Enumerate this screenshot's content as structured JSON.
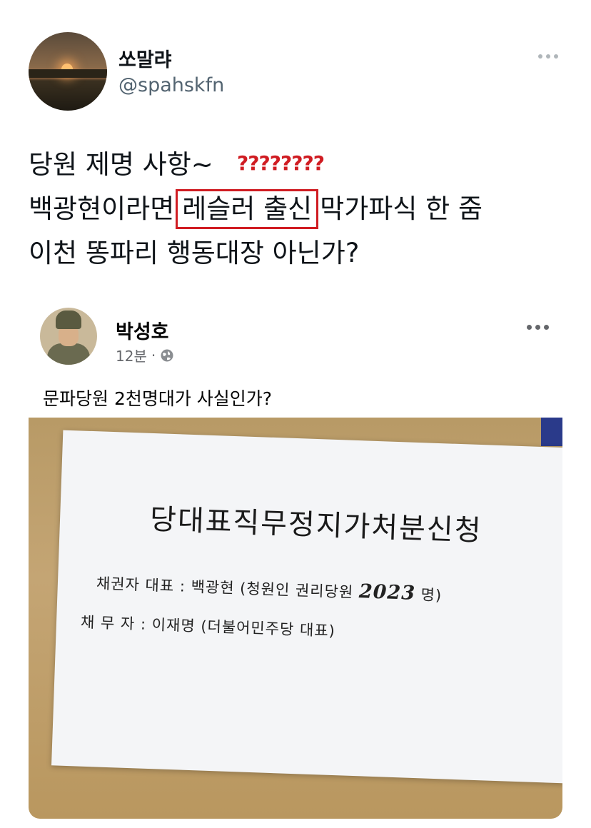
{
  "tweet": {
    "display_name": "쏘말랴",
    "handle": "@spahskfn",
    "line1": "당원 제명 사항~",
    "annotation": "????????",
    "line2_before": "백광현이라면",
    "line2_highlight": "레슬러 출신",
    "line2_after": "막가파식 한 줌",
    "line3": "이천 똥파리 행동대장 아닌가?"
  },
  "embedded_post": {
    "name": "박성호",
    "time": "12분",
    "separator": "·",
    "text": "문파당원 2천명대가 사실인가?",
    "document": {
      "title": "당대표직무정지가처분신청",
      "line1_a": "채권자 대표 : 백광현 (청원인 권리당원",
      "line1_num": "2023",
      "line1_b": "명)",
      "line2": "채 무 자 : 이재명 (더불어민주당 대표)"
    }
  },
  "colors": {
    "annotation_red": "#d01c22",
    "handle_gray": "#536471"
  },
  "icons": [
    "more-icon",
    "globe-icon",
    "more-icon"
  ]
}
